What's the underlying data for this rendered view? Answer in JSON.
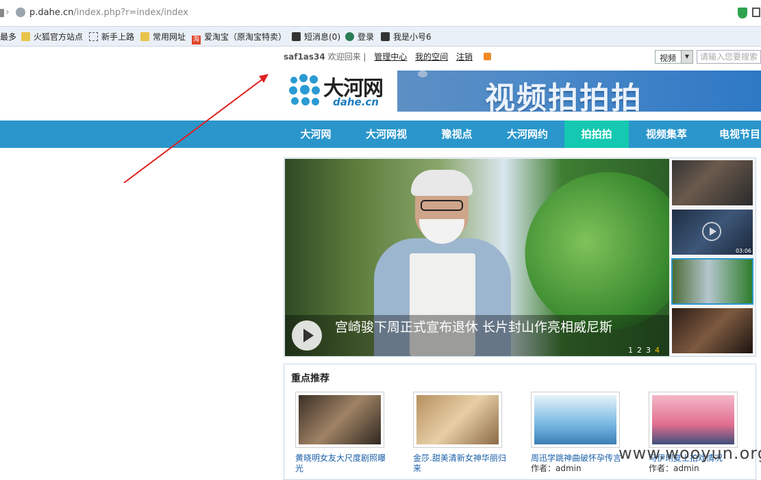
{
  "browser": {
    "url_host": "p.dahe.cn",
    "url_path": "/index.php?r=index/index",
    "bookmarks": [
      {
        "label": "最多",
        "icon": "none-icon"
      },
      {
        "label": "火狐官方站点",
        "icon": "folder-icon"
      },
      {
        "label": "新手上路",
        "icon": "dotted-folder-icon"
      },
      {
        "label": "常用网址",
        "icon": "folder-icon"
      },
      {
        "label": "爱淘宝（原淘宝特卖）",
        "icon": "taobao-icon"
      },
      {
        "label": "短消息(0)",
        "icon": "mail-icon"
      },
      {
        "label": "登录",
        "icon": "login-icon"
      },
      {
        "label": "我是小号6",
        "icon": "user-icon"
      }
    ]
  },
  "topbar": {
    "username": "saf1as34",
    "welcome": " 欢迎回来 |",
    "links": [
      "管理中心",
      "我的空间",
      "注销"
    ],
    "search_select": "视频",
    "search_placeholder": "请输入您要搜索"
  },
  "logo": {
    "cn": "大河网",
    "en": "dahe.cn"
  },
  "banner": {
    "text": "视频拍拍拍"
  },
  "nav": {
    "items": [
      "大河网",
      "大河网视",
      "豫视点",
      "大河网约",
      "拍拍拍",
      "视频集萃",
      "电视节目"
    ],
    "active_index": 4
  },
  "slider": {
    "caption": "宫崎骏下周正式宣布退休  长片封山作亮相威尼斯",
    "pages": [
      "1",
      "2",
      "3",
      "4"
    ],
    "current_page": 4,
    "thumb_duration": "03:06"
  },
  "recommend": {
    "title": "重点推荐",
    "items": [
      {
        "title": "黄晓明女友大尺度剧照曝光",
        "author": ""
      },
      {
        "title": "金莎.甜美清新女神华丽归来",
        "author": ""
      },
      {
        "title": "周迅学跳神曲破怀孕传言",
        "author": "作者：admin"
      },
      {
        "title": "马伊琍复上拍戏情况",
        "author": "作者：admin"
      }
    ]
  },
  "watermark": "www.wooyun.org",
  "colors": {
    "nav": "#2a96cb",
    "nav_active": "#14c8b1",
    "annotation_arrow": "#e02020"
  }
}
